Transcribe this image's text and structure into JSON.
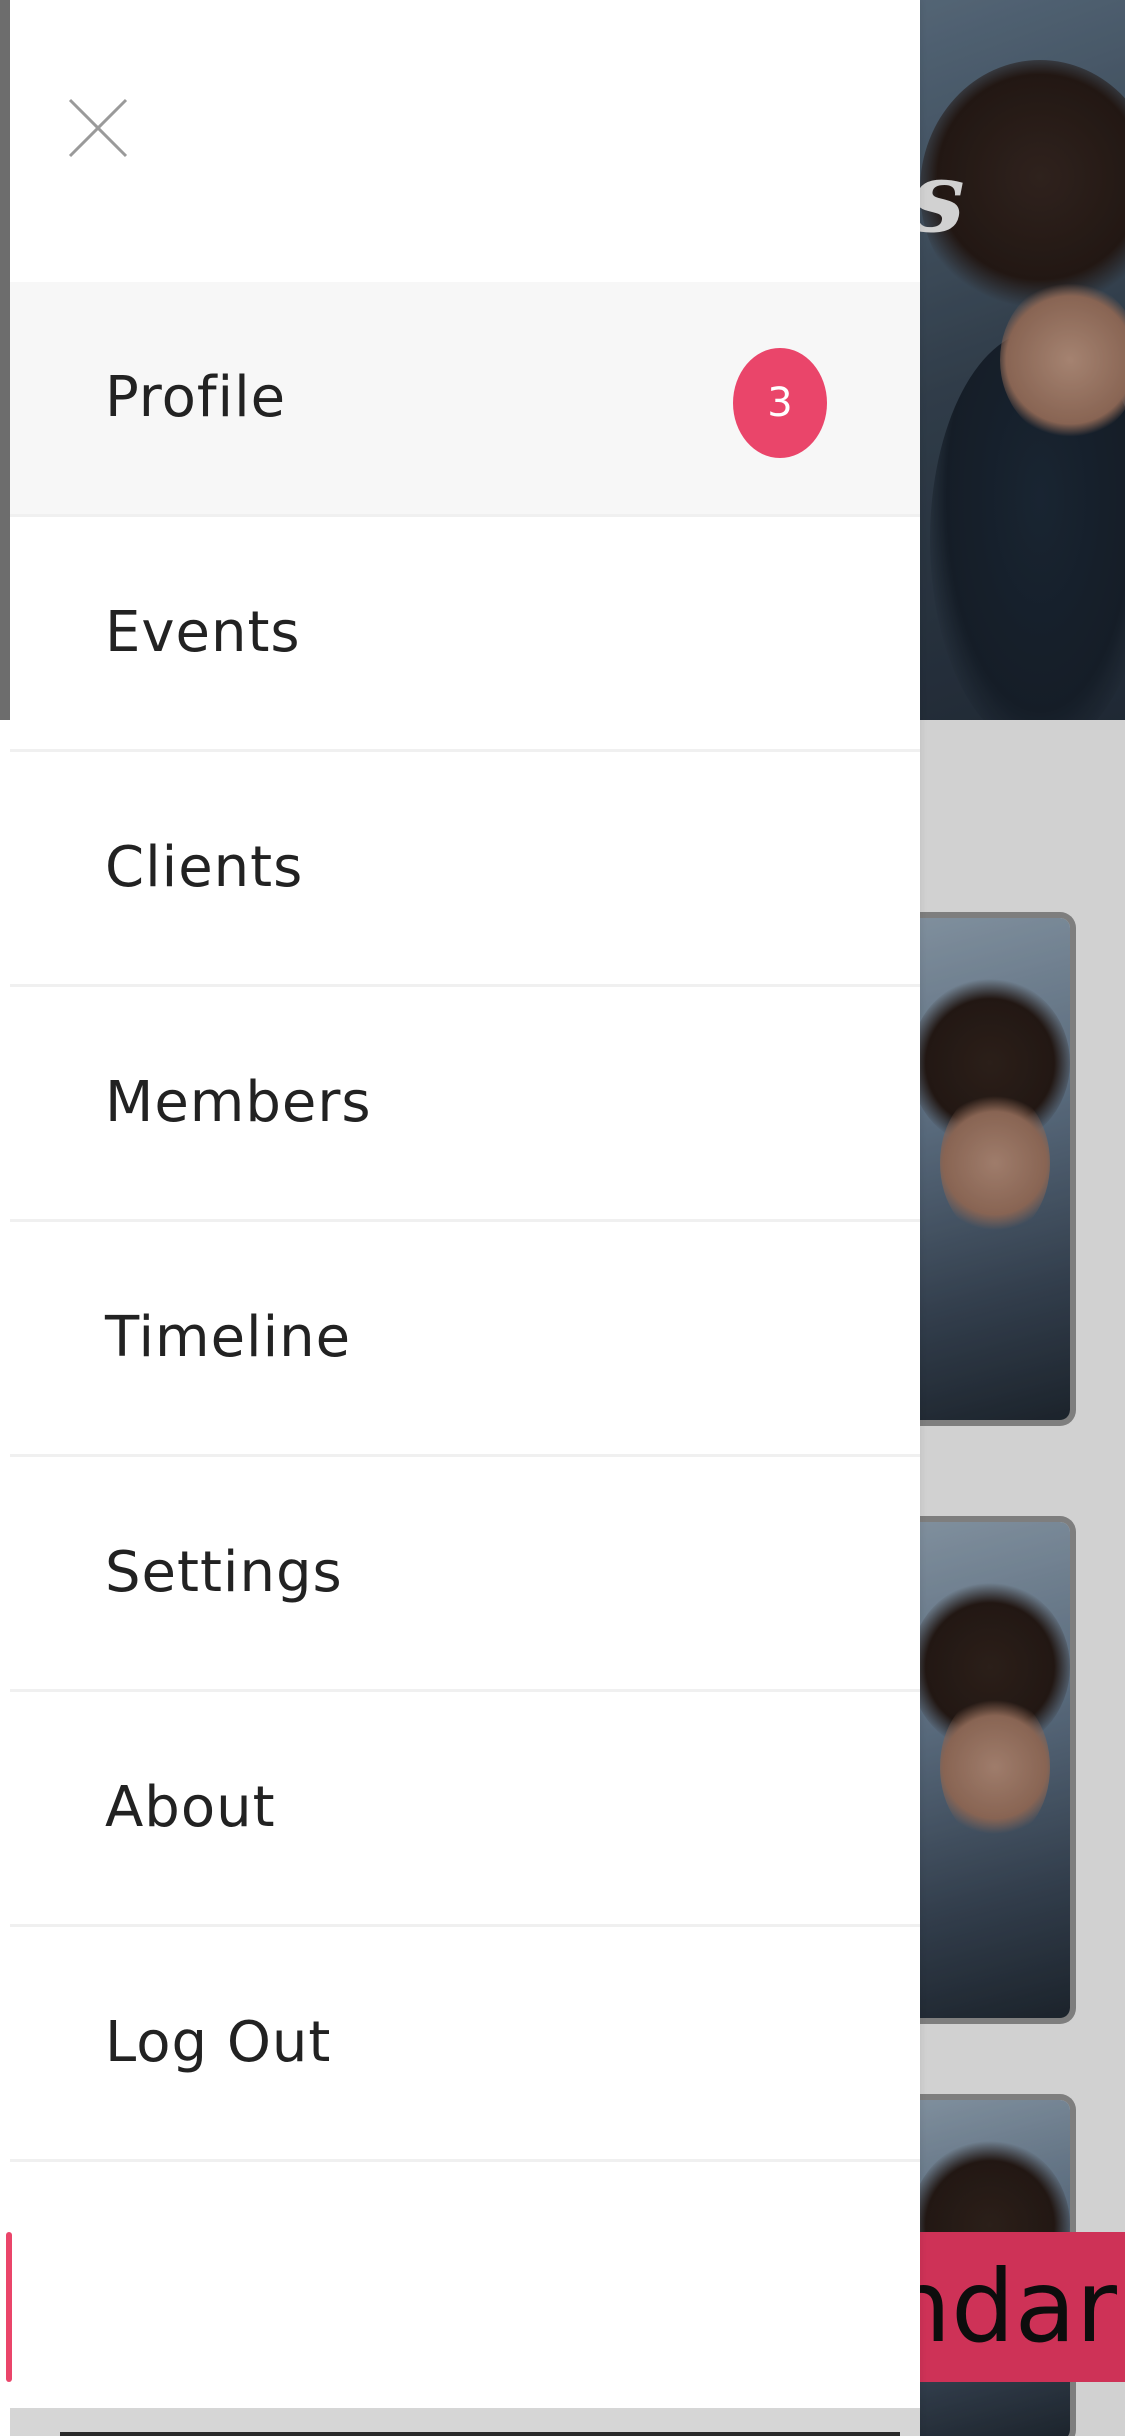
{
  "background_page": {
    "hero_title_fragment": "rs",
    "calendar_button_fragment": "ndar",
    "accent_color": "#fc3d6b"
  },
  "drawer": {
    "close_icon": "close-icon",
    "menu_items": [
      {
        "label": "Profile",
        "badge": "3",
        "active": true
      },
      {
        "label": "Events"
      },
      {
        "label": "Clients"
      },
      {
        "label": "Members"
      },
      {
        "label": "Timeline"
      },
      {
        "label": "Settings"
      },
      {
        "label": "About"
      },
      {
        "label": "Log Out"
      }
    ],
    "badge_color": "#ea456a"
  }
}
